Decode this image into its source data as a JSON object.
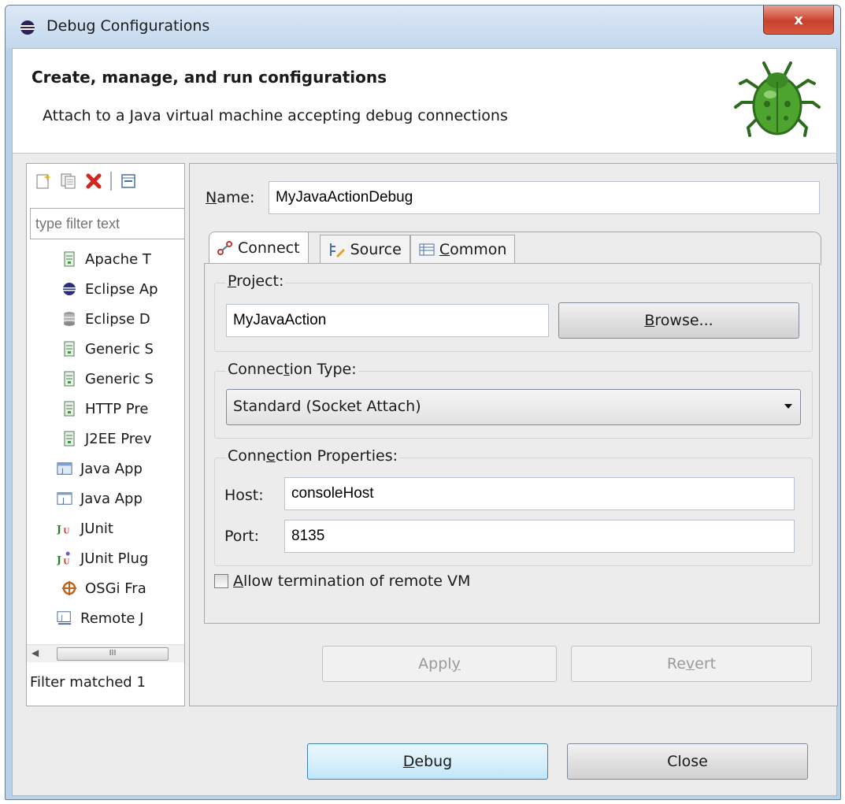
{
  "window": {
    "title": "Debug Configurations",
    "close_glyph": "x"
  },
  "header": {
    "title": "Create, manage, and run configurations",
    "description": "Attach to a Java virtual machine accepting debug connections"
  },
  "left": {
    "filter_placeholder": "type filter text",
    "items": [
      {
        "label": "Apache T",
        "icon": "server-icon"
      },
      {
        "label": "Eclipse Ap",
        "icon": "eclipse-icon"
      },
      {
        "label": "Eclipse D",
        "icon": "database-icon"
      },
      {
        "label": "Generic S",
        "icon": "server-icon"
      },
      {
        "label": "Generic S",
        "icon": "server-icon"
      },
      {
        "label": "HTTP Pre",
        "icon": "server-icon"
      },
      {
        "label": "J2EE Prev",
        "icon": "server-icon"
      },
      {
        "label": "Java App",
        "icon": "java-applet-icon"
      },
      {
        "label": "Java App",
        "icon": "java-app-icon"
      },
      {
        "label": "JUnit",
        "icon": "junit-icon"
      },
      {
        "label": "JUnit Plug",
        "icon": "junit-plugin-icon"
      },
      {
        "label": "OSGi Fra",
        "icon": "osgi-icon"
      },
      {
        "label": "Remote J",
        "icon": "remote-java-icon"
      }
    ],
    "scroll_thumb": "III",
    "filter_message": "Filter matched 1"
  },
  "form": {
    "name_label": "Name:",
    "name_value": "MyJavaActionDebug",
    "tabs": [
      "Connect",
      "Source",
      "Common"
    ],
    "project_label": "Project:",
    "project_value": "MyJavaAction",
    "browse_label": "Browse...",
    "conn_type_label": "Connection Type:",
    "conn_type_value": "Standard (Socket Attach)",
    "conn_props_label": "Connection Properties:",
    "host_label": "Host:",
    "host_value": "consoleHost",
    "port_label": "Port:",
    "port_value": "8135",
    "allow_term_label": "Allow termination of remote VM",
    "apply_label": "Apply",
    "revert_label": "Revert"
  },
  "footer": {
    "debug_label": "Debug",
    "close_label": "Close"
  }
}
